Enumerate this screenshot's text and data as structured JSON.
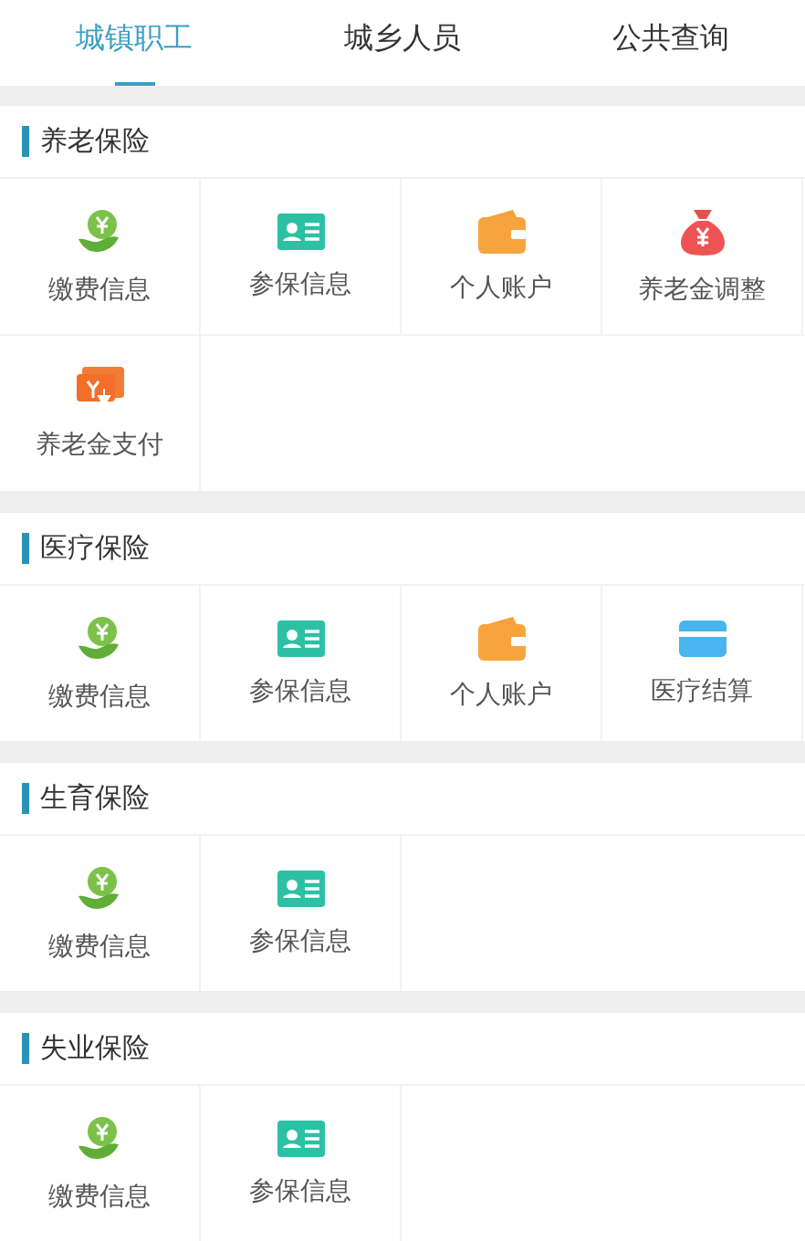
{
  "tabs": [
    {
      "label": "城镇职工",
      "selected": true
    },
    {
      "label": "城乡人员",
      "selected": false
    },
    {
      "label": "公共查询",
      "selected": false
    }
  ],
  "sections": [
    {
      "title": "养老保险",
      "items": [
        {
          "label": "缴费信息",
          "kind": "payment"
        },
        {
          "label": "参保信息",
          "kind": "idcard"
        },
        {
          "label": "个人账户",
          "kind": "wallet"
        },
        {
          "label": "养老金调整",
          "kind": "moneybag"
        },
        {
          "label": "养老金支付",
          "kind": "transfer"
        }
      ]
    },
    {
      "title": "医疗保险",
      "items": [
        {
          "label": "缴费信息",
          "kind": "payment"
        },
        {
          "label": "参保信息",
          "kind": "idcard"
        },
        {
          "label": "个人账户",
          "kind": "wallet"
        },
        {
          "label": "医疗结算",
          "kind": "bankcard"
        }
      ]
    },
    {
      "title": "生育保险",
      "items": [
        {
          "label": "缴费信息",
          "kind": "payment"
        },
        {
          "label": "参保信息",
          "kind": "idcard"
        }
      ]
    },
    {
      "title": "失业保险",
      "items": [
        {
          "label": "缴费信息",
          "kind": "payment"
        },
        {
          "label": "参保信息",
          "kind": "idcard"
        }
      ]
    }
  ]
}
